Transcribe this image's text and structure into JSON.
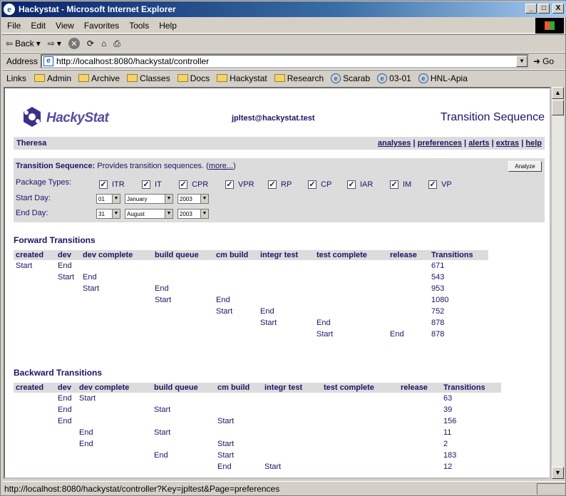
{
  "window": {
    "title": "Hackystat - Microsoft Internet Explorer",
    "min_glyph": "_",
    "max_glyph": "□",
    "close_glyph": "X"
  },
  "menu": [
    "File",
    "Edit",
    "View",
    "Favorites",
    "Tools",
    "Help"
  ],
  "toolbar": {
    "back": "Back"
  },
  "address": {
    "label": "Address",
    "url": "http://localhost:8080/hackystat/controller",
    "go": "Go"
  },
  "links": {
    "label": "Links",
    "items": [
      "Admin",
      "Archive",
      "Classes",
      "Docs",
      "Hackystat",
      "Research",
      "Scarab",
      "03-01",
      "HNL-Apia"
    ]
  },
  "page": {
    "logo": "HackyStat",
    "email": "jpltest@hackystat.test",
    "title": "Transition Sequence",
    "user": "Theresa",
    "nav": [
      "analyses",
      "preferences",
      "alerts",
      "extras",
      "help"
    ],
    "desc_title": "Transition Sequence:",
    "desc_text": " Provides transition sequences. (",
    "more": "more...",
    "desc_close": ")",
    "analyze": "Analyze",
    "package_label": "Package Types:",
    "packages": [
      "ITR",
      "IT",
      "CPR",
      "VPR",
      "RP",
      "CP",
      "IAR",
      "IM",
      "VP"
    ],
    "start_label": "Start Day:",
    "end_label": "End Day:",
    "start": {
      "day": "01",
      "month": "January",
      "year": "2003"
    },
    "end": {
      "day": "31",
      "month": "August",
      "year": "2003"
    }
  },
  "forward": {
    "title": "Forward Transitions",
    "headers": [
      "created",
      "dev",
      "dev complete",
      "build queue",
      "cm build",
      "integr test",
      "test complete",
      "release",
      "Transitions"
    ],
    "rows": [
      [
        "Start",
        "End",
        "",
        "",
        "",
        "",
        "",
        "",
        "671"
      ],
      [
        "",
        "Start",
        "End",
        "",
        "",
        "",
        "",
        "",
        "543"
      ],
      [
        "",
        "",
        "Start",
        "End",
        "",
        "",
        "",
        "",
        "953"
      ],
      [
        "",
        "",
        "",
        "Start",
        "End",
        "",
        "",
        "",
        "1080"
      ],
      [
        "",
        "",
        "",
        "",
        "Start",
        "End",
        "",
        "",
        "752"
      ],
      [
        "",
        "",
        "",
        "",
        "",
        "Start",
        "End",
        "",
        "878"
      ],
      [
        "",
        "",
        "",
        "",
        "",
        "",
        "Start",
        "End",
        "878"
      ]
    ]
  },
  "backward": {
    "title": "Backward Transitions",
    "headers": [
      "created",
      "dev",
      "dev complete",
      "build queue",
      "cm build",
      "integr test",
      "test complete",
      "release",
      "Transitions"
    ],
    "rows": [
      [
        "",
        "End",
        "Start",
        "",
        "",
        "",
        "",
        "",
        "63"
      ],
      [
        "",
        "End",
        "",
        "Start",
        "",
        "",
        "",
        "",
        "39"
      ],
      [
        "",
        "End",
        "",
        "",
        "Start",
        "",
        "",
        "",
        "156"
      ],
      [
        "",
        "",
        "End",
        "Start",
        "",
        "",
        "",
        "",
        "11"
      ],
      [
        "",
        "",
        "End",
        "",
        "Start",
        "",
        "",
        "",
        "2"
      ],
      [
        "",
        "",
        "",
        "End",
        "Start",
        "",
        "",
        "",
        "183"
      ],
      [
        "",
        "",
        "",
        "",
        "End",
        "Start",
        "",
        "",
        "12"
      ]
    ]
  },
  "status": "http://localhost:8080/hackystat/controller?Key=jpltest&Page=preferences"
}
